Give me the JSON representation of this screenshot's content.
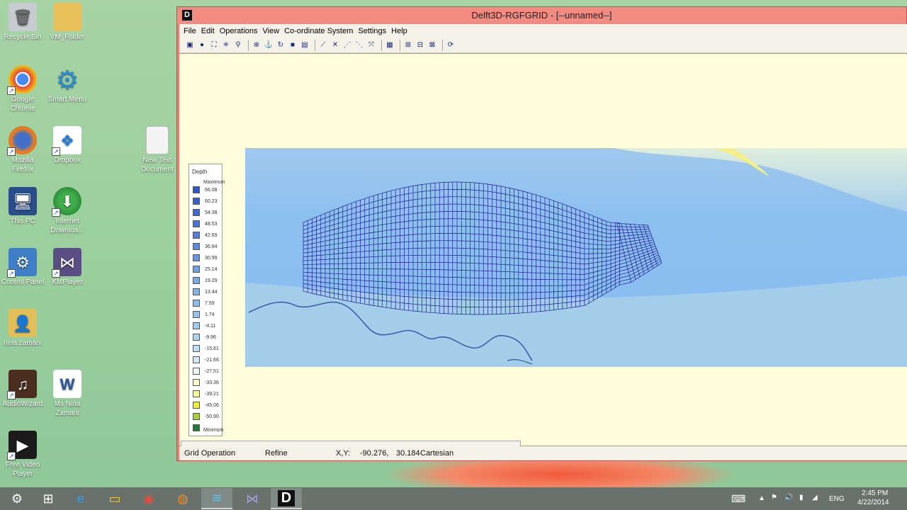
{
  "desktop": {
    "icons": [
      {
        "label": "Recycle Bin",
        "icon": "recycle-bin-icon"
      },
      {
        "label": "VM_Folder",
        "icon": "folder-icon"
      },
      {
        "label": "Google Chrome",
        "icon": "chrome-icon"
      },
      {
        "label": "Smart Menu",
        "icon": "gear-icon"
      },
      {
        "label": "Mozilla Firefox",
        "icon": "firefox-icon"
      },
      {
        "label": "Dropbox",
        "icon": "dropbox-icon"
      },
      {
        "label": "New Text Document",
        "icon": "text-document-icon"
      },
      {
        "label": "This PC",
        "icon": "computer-icon"
      },
      {
        "label": "Internet Downloa...",
        "icon": "download-manager-icon"
      },
      {
        "label": "Control Panel",
        "icon": "control-panel-icon"
      },
      {
        "label": "KMPlayer",
        "icon": "kmplayer-icon"
      },
      {
        "label": "nina zamani",
        "icon": "user-folder-icon"
      },
      {
        "label": "AudioWizard",
        "icon": "audio-wizard-icon"
      },
      {
        "label": "Ms Nina Zamani",
        "icon": "word-document-icon"
      },
      {
        "label": "Free Video Player",
        "icon": "video-player-icon"
      }
    ]
  },
  "window": {
    "app_icon_letter": "D",
    "title": "Delft3D-RGFGRID - [--unnamed--]",
    "menu": [
      "File",
      "Edit",
      "Operations",
      "View",
      "Co-ordinate System",
      "Settings",
      "Help"
    ],
    "toolbar_icons": [
      "save-icon",
      "globe-icon",
      "zoom-box-icon",
      "zoom-out-icon",
      "magnify-icon",
      "pan-icon",
      "anchor-icon",
      "refresh-icon",
      "stop-icon",
      "select-icon",
      "spline-icon",
      "delete-spline-icon",
      "spline-point-icon",
      "spline-insert-icon",
      "spline-move-icon",
      "grid-icon",
      "grid-refine-icon",
      "grid-derefine-icon",
      "grid-delete-icon",
      "redraw-icon"
    ],
    "legend": {
      "title": "Depth",
      "max_label": "Maximum",
      "min_label": "Minimum",
      "entries": [
        {
          "value": "66.08",
          "color": "#2f57c9"
        },
        {
          "value": "60.23",
          "color": "#3660cd"
        },
        {
          "value": "54.38",
          "color": "#3e69d1"
        },
        {
          "value": "48.53",
          "color": "#4974d5"
        },
        {
          "value": "42.69",
          "color": "#527fd9"
        },
        {
          "value": "36.84",
          "color": "#5c8adc"
        },
        {
          "value": "30.99",
          "color": "#6795df"
        },
        {
          "value": "25.14",
          "color": "#70a0e2"
        },
        {
          "value": "19.29",
          "color": "#7aaae5"
        },
        {
          "value": "13.44",
          "color": "#84b3e8"
        },
        {
          "value": "7.59",
          "color": "#8dbcea"
        },
        {
          "value": "1.74",
          "color": "#97c4ec"
        },
        {
          "value": "-4.11",
          "color": "#a3cbee"
        },
        {
          "value": "-9.96",
          "color": "#b0d3f0"
        },
        {
          "value": "-15.81",
          "color": "#c1ddf2"
        },
        {
          "value": "-21.66",
          "color": "#d4e8f3"
        },
        {
          "value": "-27.51",
          "color": "#eef6f4"
        },
        {
          "value": "-33.36",
          "color": "#fbfbd0"
        },
        {
          "value": "-39.21",
          "color": "#f7f79a"
        },
        {
          "value": "-45.06",
          "color": "#eeee3c"
        },
        {
          "value": "-50.90",
          "color": "#a5d23c"
        },
        {
          "value": "",
          "color": "#1f7a3c"
        }
      ]
    },
    "status": {
      "operation_label": "Grid Operation",
      "operation_value": "Refine",
      "xy_label": "X,Y:",
      "x_value": "-90.276,",
      "y_value": "30.184",
      "coord_system": "Cartesian"
    }
  },
  "taskbar": {
    "items": [
      "settings-icon",
      "windows-start-icon",
      "internet-explorer-icon",
      "file-explorer-icon",
      "chrome-icon",
      "firefox-icon",
      "delft3d-icon",
      "kmplayer-icon",
      "delft3d-rgfgrid-icon"
    ],
    "language": "ENG",
    "time": "2:45 PM",
    "date": "4/22/2014"
  }
}
